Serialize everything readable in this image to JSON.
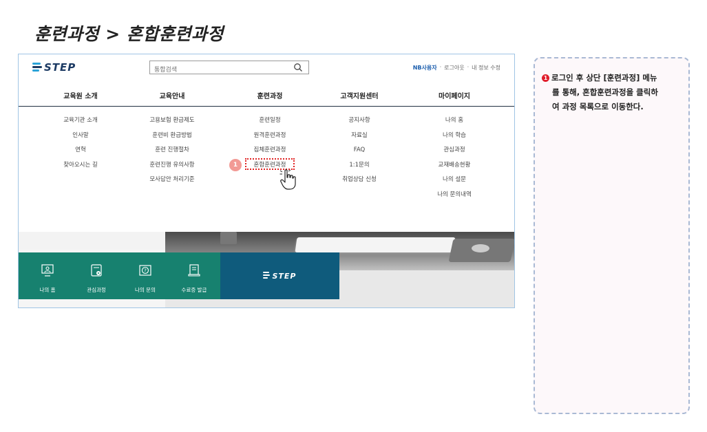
{
  "page": {
    "title": "훈련과정 > 혼합훈련과정"
  },
  "header": {
    "logo_text": "STEP",
    "search_placeholder": "통합검색",
    "util": {
      "user": "NB사용자",
      "sep": "·",
      "logout": "로그아웃",
      "my_info": "내 정보 수정"
    }
  },
  "gnb": [
    "교육원 소개",
    "교육안내",
    "훈련과정",
    "고객지원센터",
    "마이페이지"
  ],
  "submenu": [
    [
      "교육기관 소개",
      "인사말",
      "연혁",
      "찾아오시는 길"
    ],
    [
      "고용보험 환급제도",
      "훈련비 환급방법",
      "훈련 진행절차",
      "훈련진행 유의사항",
      "모사답안 처리기준"
    ],
    [
      "훈련일정",
      "원격훈련과정",
      "집체훈련과정",
      "혼합훈련과정"
    ],
    [
      "공지사항",
      "자료실",
      "FAQ",
      "1:1문의",
      "취업상담 신청"
    ],
    [
      "나의 홈",
      "나의 학습",
      "관심과정",
      "교재배송현황",
      "나의 설문",
      "나의 문의내역"
    ]
  ],
  "callout": {
    "number": "1"
  },
  "quick_menu": [
    {
      "label": "나의 홈",
      "icon": "monitor-user-icon"
    },
    {
      "label": "관심과정",
      "icon": "heart-board-icon"
    },
    {
      "label": "나의 문의",
      "icon": "question-book-icon"
    },
    {
      "label": "수료증 발급",
      "icon": "certificate-icon"
    }
  ],
  "quick_logo": "STEP",
  "instruction": {
    "number": "1",
    "line1": "로그인 후 상단 [훈련과정] 메뉴",
    "line2": "를 통해, 혼합훈련과정을 클릭하",
    "line3": "여 과정 목록으로 이동한다."
  },
  "colors": {
    "accent_green": "#17816f",
    "accent_blue": "#0f5b7c",
    "highlight_red": "#e02020"
  }
}
